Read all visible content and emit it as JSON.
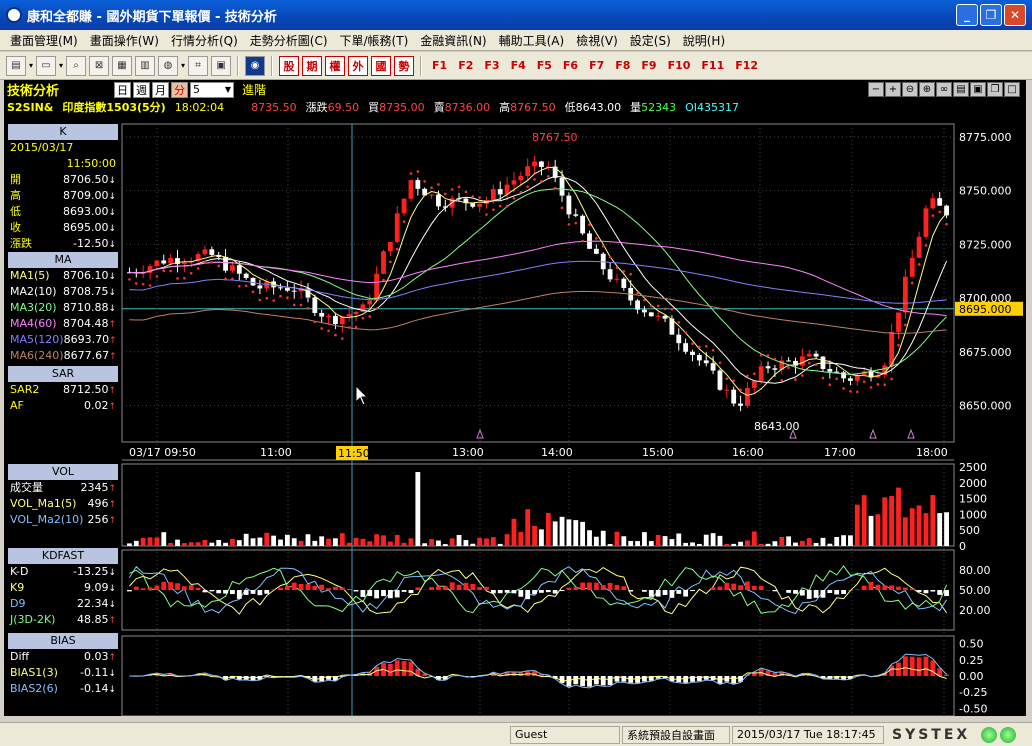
{
  "window": {
    "title": "康和全都賺 - 國外期貨下單報價 - 技術分析"
  },
  "menu": [
    "畫面管理(M)",
    "畫面操作(W)",
    "行情分析(Q)",
    "走勢分析圖(C)",
    "下單/帳務(T)",
    "金融資訊(N)",
    "輔助工具(A)",
    "檢視(V)",
    "設定(S)",
    "說明(H)"
  ],
  "toolbar": {
    "red_buttons": [
      "股",
      "期",
      "權",
      "外",
      "國",
      "勢"
    ],
    "fkeys": [
      "F1",
      "F2",
      "F3",
      "F4",
      "F5",
      "F6",
      "F7",
      "F8",
      "F9",
      "F10",
      "F11",
      "F12"
    ]
  },
  "chart_header": {
    "title": "技術分析",
    "period_day": "日",
    "period_week": "週",
    "period_month": "月",
    "period_minute": "分",
    "interval": "5",
    "advanced": "進階",
    "symbol": "S2SIN&",
    "name": "印度指數1503(5分)",
    "time": "18:02:04",
    "last": "8735.50",
    "change_label": "漲跌",
    "change": "69.50",
    "bid_label": "買",
    "bid": "8735.00",
    "ask_label": "賣",
    "ask": "8736.00",
    "high_label": "高",
    "high": "8767.50",
    "low_label": "低",
    "low": "8643.00",
    "vol_label": "量",
    "vol": "52343",
    "oi": "OI435317"
  },
  "panels": {
    "k": {
      "title": "K",
      "date": "2015/03/17",
      "time": "11:50:00",
      "rows": [
        {
          "label": "開",
          "value": "8706.50",
          "dir": "down"
        },
        {
          "label": "高",
          "value": "8709.00",
          "dir": "down"
        },
        {
          "label": "低",
          "value": "8693.00",
          "dir": "down"
        },
        {
          "label": "收",
          "value": "8695.00",
          "dir": "down"
        },
        {
          "label": "漲跌",
          "value": "-12.50",
          "dir": "down"
        }
      ]
    },
    "ma": {
      "title": "MA",
      "rows": [
        {
          "label": "MA1(5)",
          "value": "8706.10",
          "dir": "down",
          "color": "#ffff80"
        },
        {
          "label": "MA2(10)",
          "value": "8708.75",
          "dir": "down",
          "color": "#ffffff"
        },
        {
          "label": "MA3(20)",
          "value": "8710.88",
          "dir": "down",
          "color": "#80ff80"
        },
        {
          "label": "MA4(60)",
          "value": "8704.48",
          "dir": "up",
          "color": "#ff80ff"
        },
        {
          "label": "MA5(120)",
          "value": "8693.70",
          "dir": "up",
          "color": "#8080ff"
        },
        {
          "label": "MA6(240)",
          "value": "8677.67",
          "dir": "up",
          "color": "#c08060"
        }
      ]
    },
    "sar": {
      "title": "SAR",
      "rows": [
        {
          "label": "SAR2",
          "value": "8712.50",
          "dir": "up"
        },
        {
          "label": "AF",
          "value": "0.02",
          "dir": "up"
        }
      ]
    },
    "vol": {
      "title": "VOL",
      "rows": [
        {
          "label": "成交量",
          "value": "2345",
          "dir": "up",
          "color": "#ffffff"
        },
        {
          "label": "VOL_Ma1(5)",
          "value": "496",
          "dir": "up",
          "color": "#ffff80"
        },
        {
          "label": "VOL_Ma2(10)",
          "value": "256",
          "dir": "up",
          "color": "#80c0ff"
        }
      ]
    },
    "kd": {
      "title": "KDFAST",
      "rows": [
        {
          "label": "K-D",
          "value": "-13.25",
          "dir": "down",
          "color": "#ffffff"
        },
        {
          "label": "K9",
          "value": "9.09",
          "dir": "down",
          "color": "#ffff80"
        },
        {
          "label": "D9",
          "value": "22.34",
          "dir": "down",
          "color": "#80c0ff"
        },
        {
          "label": "J(3D-2K)",
          "value": "48.85",
          "dir": "up",
          "color": "#80ff80"
        }
      ]
    },
    "bias": {
      "title": "BIAS",
      "rows": [
        {
          "label": "Diff",
          "value": "0.03",
          "dir": "up",
          "color": "#ffffff"
        },
        {
          "label": "BIAS1(3)",
          "value": "-0.11",
          "dir": "down",
          "color": "#ffff80"
        },
        {
          "label": "BIAS2(6)",
          "value": "-0.14",
          "dir": "down",
          "color": "#80c0ff"
        }
      ]
    }
  },
  "axes": {
    "price_ticks": [
      "8775.000",
      "8750.000",
      "8725.000",
      "8700.000",
      "8675.000",
      "8650.000"
    ],
    "current_price_tag": "8695.000",
    "time_ticks": [
      "03/17 09:50",
      "11:00",
      "13:00",
      "14:00",
      "15:00",
      "16:00",
      "17:00",
      "18:00"
    ],
    "cursor_time": "11:50",
    "vol_ticks": [
      "2500",
      "2000",
      "1500",
      "1000",
      "500",
      "0"
    ],
    "kd_ticks": [
      "80.00",
      "50.00",
      "20.00"
    ],
    "bias_ticks": [
      "0.50",
      "0.25",
      "0.00",
      "-0.25",
      "-0.50"
    ],
    "high_label": "8767.50",
    "low_label": "8643.00"
  },
  "colors": {
    "up": "#ff2020",
    "down": "#ffffff",
    "sar": "#ff3030",
    "grid": "#404040",
    "cursor": "#40a0c0",
    "price_tag": "#ffd000"
  },
  "status": {
    "user": "Guest",
    "layout": "系統預設自設畫面",
    "datetime": "2015/03/17 Tue 18:17:45",
    "brand": "SYSTEX"
  }
}
